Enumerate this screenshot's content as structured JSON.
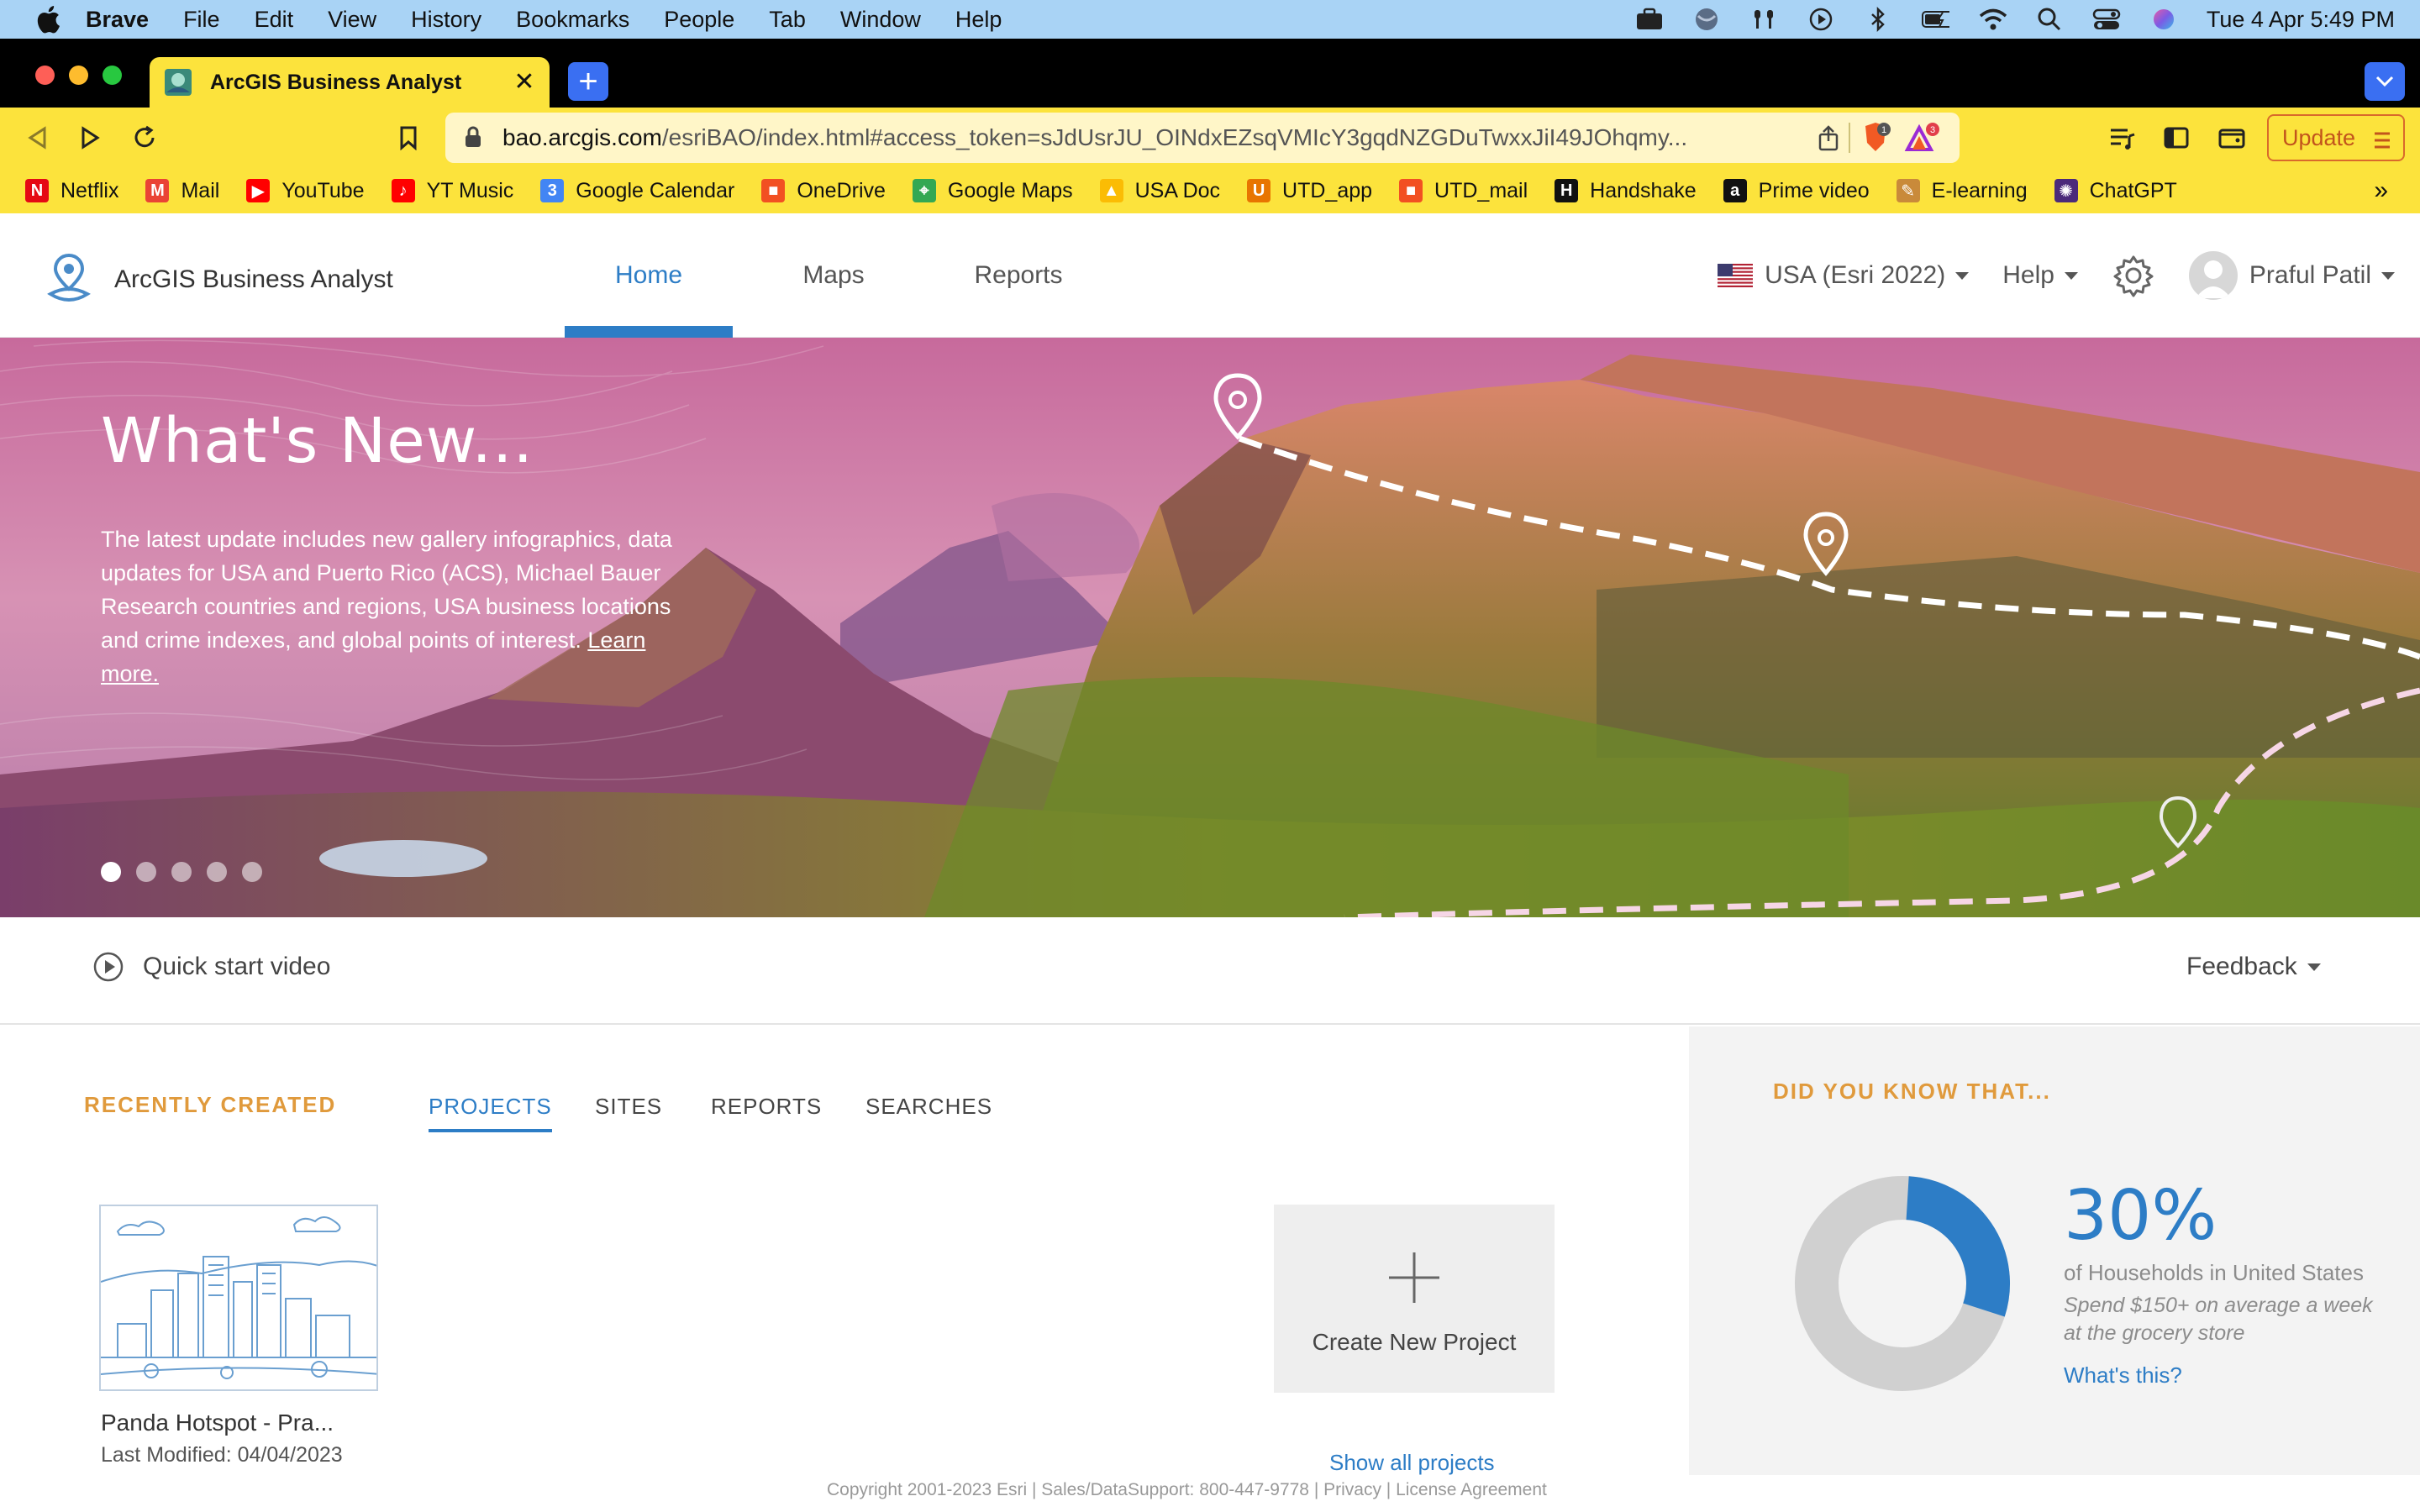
{
  "menubar": {
    "app_name": "Brave",
    "items": [
      "File",
      "Edit",
      "View",
      "History",
      "Bookmarks",
      "People",
      "Tab",
      "Window",
      "Help"
    ],
    "clock": "Tue 4 Apr  5:49 PM",
    "status_icons": [
      "briefcase-icon",
      "vpn-globe-icon",
      "airpods-icon",
      "play-icon",
      "bluetooth-icon",
      "battery-icon",
      "wifi-icon",
      "search-icon",
      "control-center-icon",
      "siri-icon"
    ]
  },
  "browser": {
    "tab_title": "ArcGIS Business Analyst",
    "url_host": "bao.arcgis.com",
    "url_path": "/esriBAO/index.html#access_token=sJdUsrJU_OINdxEZsqVMIcY3gqdNZGDuTwxxJiI49JOhqmy...",
    "shield_count": "1",
    "rewards_count": "3",
    "update_label": "Update",
    "accent": "#fce33c"
  },
  "bookmarks": [
    {
      "label": "Netflix",
      "icon": "netflix-icon",
      "color": "#e50914",
      "glyph": "N"
    },
    {
      "label": "Mail",
      "icon": "gmail-icon",
      "color": "#ea4335",
      "glyph": "M"
    },
    {
      "label": "YouTube",
      "icon": "youtube-icon",
      "color": "#ff0000",
      "glyph": "▶"
    },
    {
      "label": "YT Music",
      "icon": "yt-music-icon",
      "color": "#ff0000",
      "glyph": "♪"
    },
    {
      "label": "Google Calendar",
      "icon": "calendar-icon",
      "color": "#4285f4",
      "glyph": "3"
    },
    {
      "label": "OneDrive",
      "icon": "onedrive-icon",
      "color": "#f25022",
      "glyph": "■"
    },
    {
      "label": "Google Maps",
      "icon": "maps-icon",
      "color": "#34a853",
      "glyph": "⌖"
    },
    {
      "label": "USA Doc",
      "icon": "drive-icon",
      "color": "#fbbc04",
      "glyph": "▲"
    },
    {
      "label": "UTD_app",
      "icon": "utd-app-icon",
      "color": "#e87500",
      "glyph": "U"
    },
    {
      "label": "UTD_mail",
      "icon": "utd-mail-icon",
      "color": "#f25022",
      "glyph": "■"
    },
    {
      "label": "Handshake",
      "icon": "handshake-icon",
      "color": "#111111",
      "glyph": "H"
    },
    {
      "label": "Prime video",
      "icon": "amazon-icon",
      "color": "#111111",
      "glyph": "a"
    },
    {
      "label": "E-learning",
      "icon": "elearning-icon",
      "color": "#c98a3a",
      "glyph": "✎"
    },
    {
      "label": "ChatGPT",
      "icon": "chatgpt-icon",
      "color": "#4b2a7a",
      "glyph": "✺"
    }
  ],
  "app": {
    "brand": "ArcGIS Business Analyst",
    "nav": [
      {
        "label": "Home",
        "active": true
      },
      {
        "label": "Maps",
        "active": false
      },
      {
        "label": "Reports",
        "active": false
      }
    ],
    "region": "USA (Esri 2022)",
    "help": "Help",
    "user": "Praful Patil",
    "primary_color": "#2d7dc6"
  },
  "hero": {
    "title": "What's New...",
    "body": "The latest update includes new gallery infographics, data updates for USA and Puerto Rico (ACS), Michael Bauer Research countries and regions, USA business locations and crime indexes, and global points of interest.",
    "link": "Learn more.",
    "slide_count": 5,
    "active_slide": 1
  },
  "quickbar": {
    "video_label": "Quick start video",
    "feedback_label": "Feedback"
  },
  "recent": {
    "heading": "RECENTLY CREATED",
    "tabs": [
      "PROJECTS",
      "SITES",
      "REPORTS",
      "SEARCHES"
    ],
    "active_tab": "PROJECTS",
    "projects": [
      {
        "name": "Panda Hotspot - Pra...",
        "modified": "Last Modified: 04/04/2023"
      }
    ],
    "create_label": "Create New Project",
    "show_all": "Show all projects",
    "copyright": "Copyright 2001-2023 Esri | Sales/DataSupport: 800-447-9778 | Privacy | License Agreement"
  },
  "did_you_know": {
    "heading": "DID YOU KNOW THAT...",
    "percent": "30%",
    "percent_value": 30,
    "subject": "of Households in United States",
    "detail": "Spend $150+ on average a week at the grocery store",
    "link": "What's this?"
  }
}
